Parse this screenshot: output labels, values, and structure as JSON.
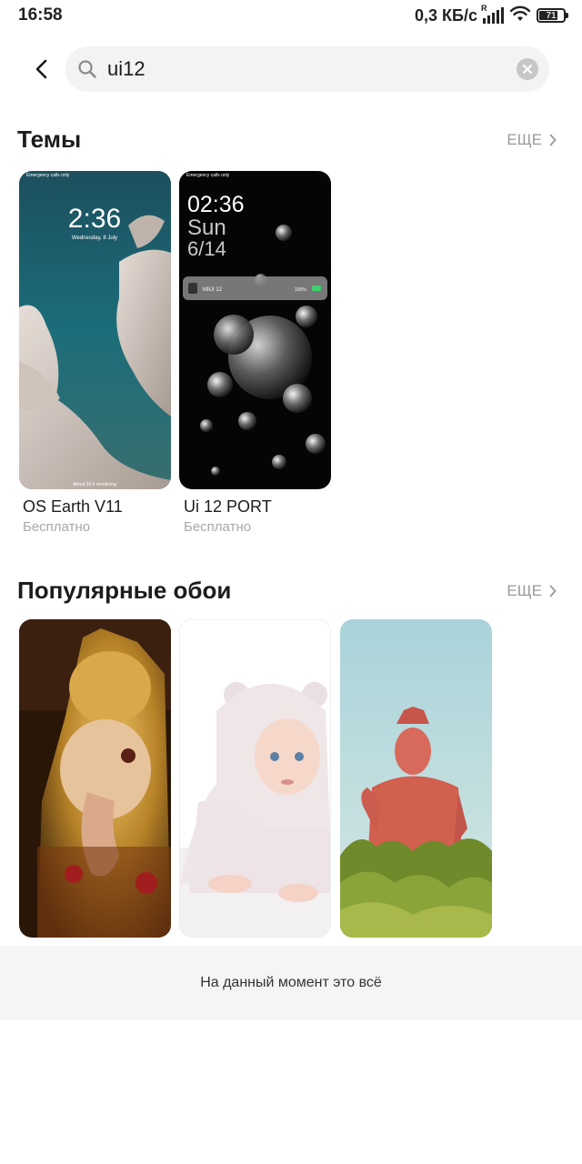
{
  "status": {
    "time": "16:58",
    "net_speed": "0,3 КБ/с",
    "signal_label": "R",
    "battery": "71"
  },
  "search": {
    "query": "ui12"
  },
  "themes": {
    "title": "Темы",
    "more": "ЕЩЕ",
    "items": [
      {
        "name": "OS Earth V11",
        "price": "Бесплатно",
        "preview": {
          "status_text": "Emergency calls only",
          "clock": "2:36",
          "date": "Wednesday, 8 July",
          "bottom_text": "About 34 h remaining"
        }
      },
      {
        "name": "Ui 12 PORT",
        "price": "Бесплатно",
        "preview": {
          "status_text": "Emergency calls only",
          "clock": "02:36",
          "day": "Sun",
          "date": "6/14",
          "notif_title": "MIUI 12",
          "notif_value": "100%"
        }
      }
    ]
  },
  "wallpapers": {
    "title": "Популярные обои",
    "more": "ЕЩЕ"
  },
  "footer": {
    "text": "На данный момент это всё"
  }
}
